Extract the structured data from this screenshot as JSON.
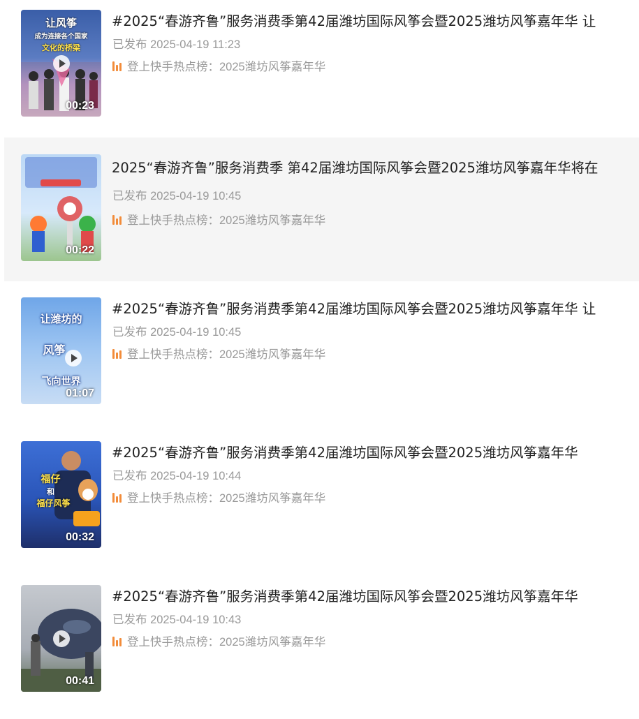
{
  "colors": {
    "accent": "#f28c3a",
    "meta_text": "#999999",
    "title_text": "#222222",
    "hover_bg": "#f5f5f5"
  },
  "items": [
    {
      "title": "#2025“春游齐鲁”服务消费季第42届潍坊国际风筝会暨2025潍坊风筝嘉年华 让",
      "date": "已发布 2025-04-19 11:23",
      "hot_label": "登上快手热点榜：2025潍坊风筝嘉年华",
      "duration": "00:23",
      "thumb_text": [
        "让风筝",
        "成为连接各个国家",
        "文化的桥梁"
      ],
      "thumb_icon": "kite-event-thumbnail"
    },
    {
      "title": "2025“春游齐鲁”服务消费季 第42届潍坊国际风筝会暨2025潍坊风筝嘉年华将在",
      "date": "已发布 2025-04-19 10:45",
      "hot_label": "登上快手热点榜：2025潍坊风筝嘉年华",
      "duration": "00:22",
      "thumb_text": [],
      "thumb_icon": "mascot-thumbnail"
    },
    {
      "title": "#2025“春游齐鲁”服务消费季第42届潍坊国际风筝会暨2025潍坊风筝嘉年华 让",
      "date": "已发布 2025-04-19 10:45",
      "hot_label": "登上快手热点榜：2025潍坊风筝嘉年华",
      "duration": "01:07",
      "thumb_text": [
        "让潍坊的",
        "风筝",
        "飞向世界"
      ],
      "thumb_icon": "sky-kite-thumbnail"
    },
    {
      "title": "#2025“春游齐鲁”服务消费季第42届潍坊国际风筝会暨2025潍坊风筝嘉年华",
      "date": "已发布 2025-04-19 10:44",
      "hot_label": "登上快手热点榜：2025潍坊风筝嘉年华",
      "duration": "00:32",
      "thumb_text": [
        "福仔",
        "和",
        "福仔风筝"
      ],
      "thumb_icon": "dog-kite-thumbnail"
    },
    {
      "title": "#2025“春游齐鲁”服务消费季第42届潍坊国际风筝会暨2025潍坊风筝嘉年华",
      "date": "已发布 2025-04-19 10:43",
      "hot_label": "登上快手热点榜：2025潍坊风筝嘉年华",
      "duration": "00:41",
      "thumb_text": [],
      "thumb_icon": "whale-kite-thumbnail"
    }
  ]
}
